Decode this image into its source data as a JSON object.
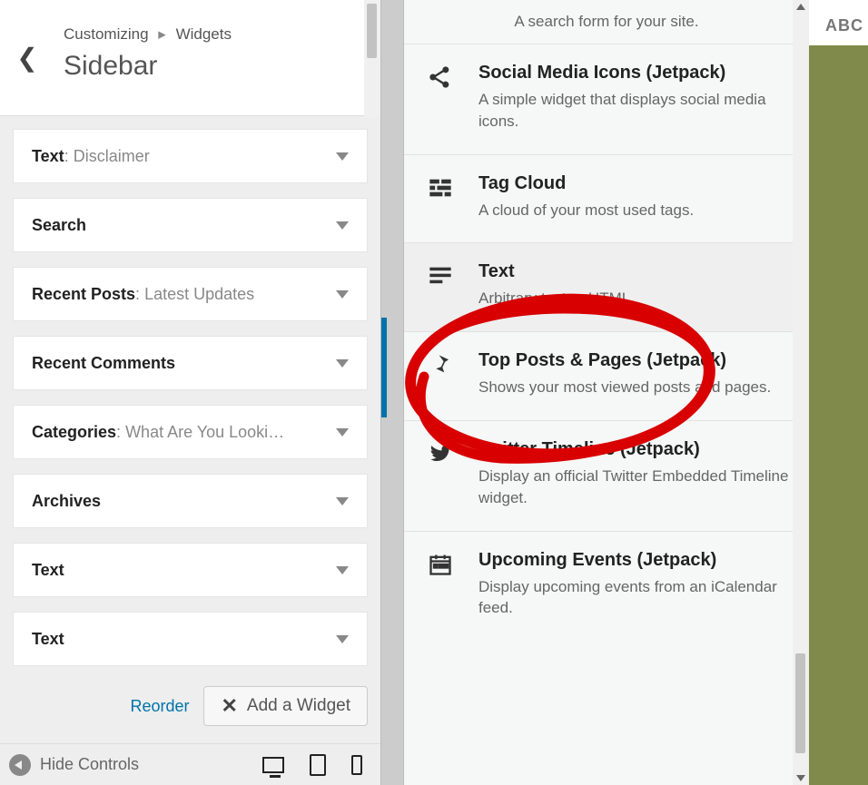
{
  "header": {
    "crumb1": "Customizing",
    "crumb2": "Widgets",
    "title": "Sidebar"
  },
  "widgets": [
    {
      "name": "Text",
      "sub": "Disclaimer"
    },
    {
      "name": "Search",
      "sub": ""
    },
    {
      "name": "Recent Posts",
      "sub": "Latest Updates"
    },
    {
      "name": "Recent Comments",
      "sub": ""
    },
    {
      "name": "Categories",
      "sub": "What Are You Looki…"
    },
    {
      "name": "Archives",
      "sub": ""
    },
    {
      "name": "Text",
      "sub": ""
    },
    {
      "name": "Text",
      "sub": ""
    }
  ],
  "actions": {
    "reorder": "Reorder",
    "add_widget": "Add a Widget"
  },
  "footer": {
    "hide_controls": "Hide Controls"
  },
  "search_hint": "A search form for your site.",
  "available": [
    {
      "icon": "share",
      "title": "Social Media Icons (Jetpack)",
      "desc": "A simple widget that displays social media icons."
    },
    {
      "icon": "tagcloud",
      "title": "Tag Cloud",
      "desc": "A cloud of your most used tags."
    },
    {
      "icon": "text",
      "title": "Text",
      "desc": "Arbitrary text or HTML.",
      "selected": true
    },
    {
      "icon": "pin",
      "title": "Top Posts & Pages (Jetpack)",
      "desc": "Shows your most viewed posts and pages."
    },
    {
      "icon": "twitter",
      "title": "Twitter Timeline (Jetpack)",
      "desc": "Display an official Twitter Embedded Timeline widget."
    },
    {
      "icon": "calendar",
      "title": "Upcoming Events (Jetpack)",
      "desc": "Display upcoming events from an iCalendar feed."
    }
  ],
  "bgtag": "ABC"
}
